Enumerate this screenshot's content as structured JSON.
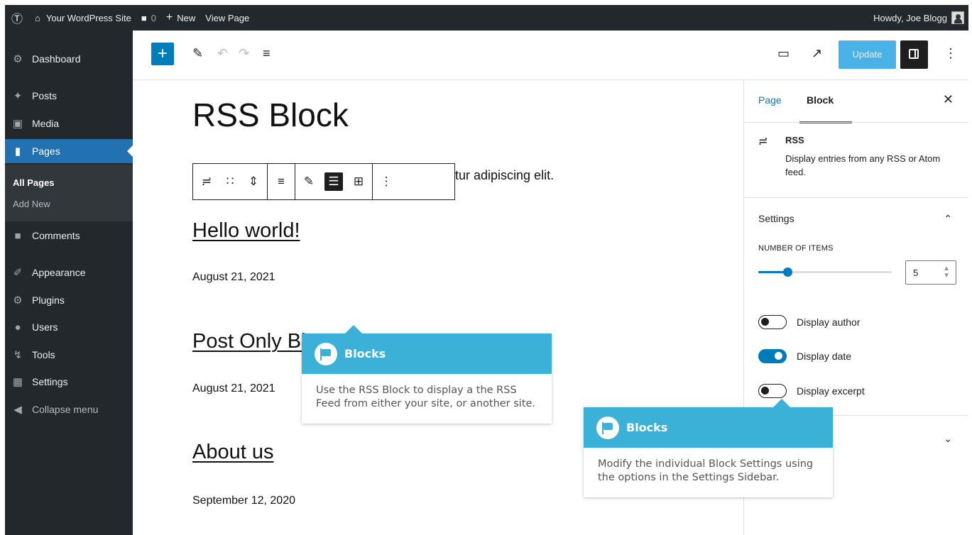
{
  "admin_bar": {
    "site_name": "Your WordPress Site",
    "comments_count": "0",
    "new_label": "New",
    "view_label": "View Page",
    "howdy": "Howdy, Joe Blogg"
  },
  "sidebar": {
    "items": [
      {
        "label": "Dashboard",
        "icon": "dashboard-icon"
      },
      {
        "label": "Posts",
        "icon": "pin-icon"
      },
      {
        "label": "Media",
        "icon": "media-icon"
      },
      {
        "label": "Pages",
        "icon": "pages-icon"
      },
      {
        "label": "Comments",
        "icon": "comment-icon"
      },
      {
        "label": "Appearance",
        "icon": "brush-icon"
      },
      {
        "label": "Plugins",
        "icon": "plugin-icon"
      },
      {
        "label": "Users",
        "icon": "users-icon"
      },
      {
        "label": "Tools",
        "icon": "wrench-icon"
      },
      {
        "label": "Settings",
        "icon": "settings-icon"
      },
      {
        "label": "Collapse menu",
        "icon": "collapse-icon"
      }
    ],
    "submenu": [
      "All Pages",
      "Add New"
    ]
  },
  "toolbar": {
    "update_label": "Update"
  },
  "content": {
    "title": "RSS Block",
    "intro_fragment": "tur adipiscing elit.",
    "posts": [
      {
        "title": "Hello world!",
        "date": "August 21, 2021"
      },
      {
        "title": "Post Only Bl",
        "date": "August 21, 2021"
      },
      {
        "title": "About us",
        "date": "September 12, 2020"
      }
    ]
  },
  "settings_panel": {
    "tab_page": "Page",
    "tab_block": "Block",
    "block_name": "RSS",
    "block_description": "Display entries from any RSS or Atom feed.",
    "section_title": "Settings",
    "number_label": "NUMBER OF ITEMS",
    "number_value": "5",
    "range_fraction": 0.22,
    "toggles": [
      {
        "label": "Display author",
        "on": false
      },
      {
        "label": "Display date",
        "on": true
      },
      {
        "label": "Display excerpt",
        "on": false
      }
    ]
  },
  "tooltips": [
    {
      "title": "Blocks",
      "body": "Use the RSS Block to display a the RSS Feed from either your site, or another site."
    },
    {
      "title": "Blocks",
      "body": "Modify the individual Block Settings using the options in the Settings Sidebar."
    }
  ],
  "colors": {
    "accent": "#007cba",
    "admin_dark": "#23282d",
    "tooltip_head": "#3cb1d8"
  }
}
